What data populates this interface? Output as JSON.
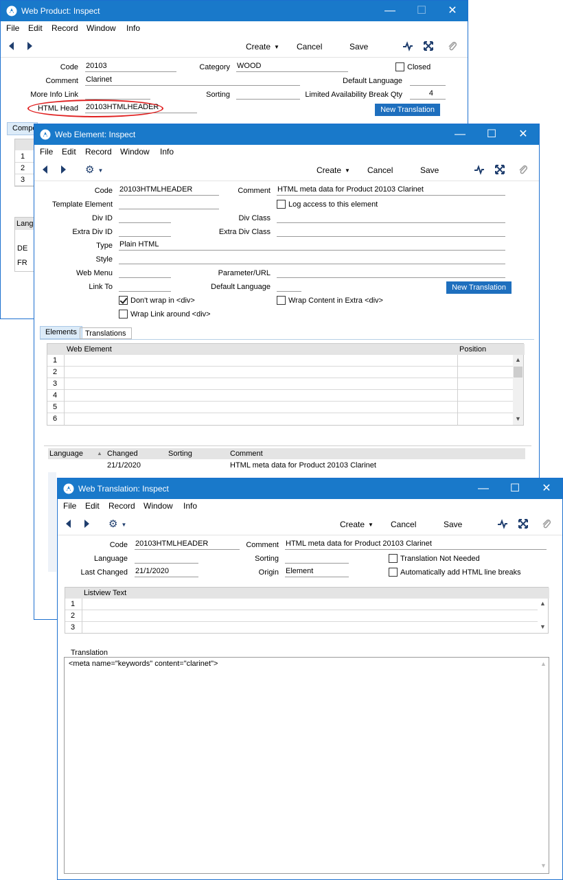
{
  "menu": [
    "File",
    "Edit",
    "Record",
    "Window",
    "Info"
  ],
  "toolbar": {
    "create": "Create",
    "cancel": "Cancel",
    "save": "Save"
  },
  "w1": {
    "title": "Web Product: Inspect",
    "code_label": "Code",
    "code": "20103",
    "category_label": "Category",
    "category": "WOOD",
    "closed_label": "Closed",
    "comment_label": "Comment",
    "comment": "Clarinet",
    "default_language_label": "Default Language",
    "default_language": "",
    "more_info_label": "More Info Link",
    "more_info": "",
    "sorting_label": "Sorting",
    "sorting": "",
    "lim_label": "Limited Availability Break Qty",
    "lim": "4",
    "html_head_label": "HTML Head",
    "html_head": "20103HTMLHEADER",
    "new_translation": "New Translation",
    "tab_components": "Compo",
    "rows": [
      "1",
      "2",
      "3"
    ],
    "lang_header": "Langu",
    "langs": [
      "DE",
      "FR"
    ]
  },
  "w2": {
    "title": "Web Element: Inspect",
    "code_label": "Code",
    "code": "20103HTMLHEADER",
    "comment_label": "Comment",
    "comment": "HTML meta data for Product 20103 Clarinet",
    "template_label": "Template Element",
    "template": "",
    "log_access_label": "Log access to this element",
    "div_id_label": "Div ID",
    "div_id": "",
    "div_class_label": "Div Class",
    "div_class": "",
    "extra_div_id_label": "Extra Div ID",
    "extra_div_id": "",
    "extra_div_class_label": "Extra Div Class",
    "extra_div_class": "",
    "type_label": "Type",
    "type": "Plain HTML",
    "style_label": "Style",
    "style": "",
    "web_menu_label": "Web Menu",
    "web_menu": "",
    "param_label": "Parameter/URL",
    "param": "",
    "link_to_label": "Link To",
    "link_to": "",
    "default_language_label": "Default Language",
    "default_language": "",
    "new_translation": "New Translation",
    "dont_wrap_label": "Don't wrap in <div>",
    "wrap_extra_label": "Wrap Content in Extra <div>",
    "wrap_link_label": "Wrap Link around <div>",
    "tab_elements": "Elements",
    "tab_translations": "Translations",
    "col_web_element": "Web Element",
    "col_position": "Position",
    "rows": [
      "1",
      "2",
      "3",
      "4",
      "5",
      "6"
    ],
    "tr_col_language": "Language",
    "tr_col_changed": "Changed",
    "tr_col_sorting": "Sorting",
    "tr_col_comment": "Comment",
    "tr_row": {
      "changed": "21/1/2020",
      "comment": "HTML meta data for Product 20103 Clarinet"
    }
  },
  "w3": {
    "title": "Web Translation: Inspect",
    "code_label": "Code",
    "code": "20103HTMLHEADER",
    "comment_label": "Comment",
    "comment": "HTML meta data for Product 20103 Clarinet",
    "language_label": "Language",
    "language": "",
    "sorting_label": "Sorting",
    "sorting": "",
    "not_needed_label": "Translation Not Needed",
    "last_changed_label": "Last Changed",
    "last_changed": "21/1/2020",
    "origin_label": "Origin",
    "origin": "Element",
    "auto_breaks_label": "Automatically add HTML line breaks",
    "col_listview": "Listview Text",
    "rows": [
      "1",
      "2",
      "3"
    ],
    "translation_label": "Translation",
    "translation_text": "<meta name=\"keywords\" content=\"clarinet\">"
  },
  "colors": {
    "titlebar": "#1979ca",
    "button": "#1e6fbe",
    "highlight": "#e02020"
  }
}
